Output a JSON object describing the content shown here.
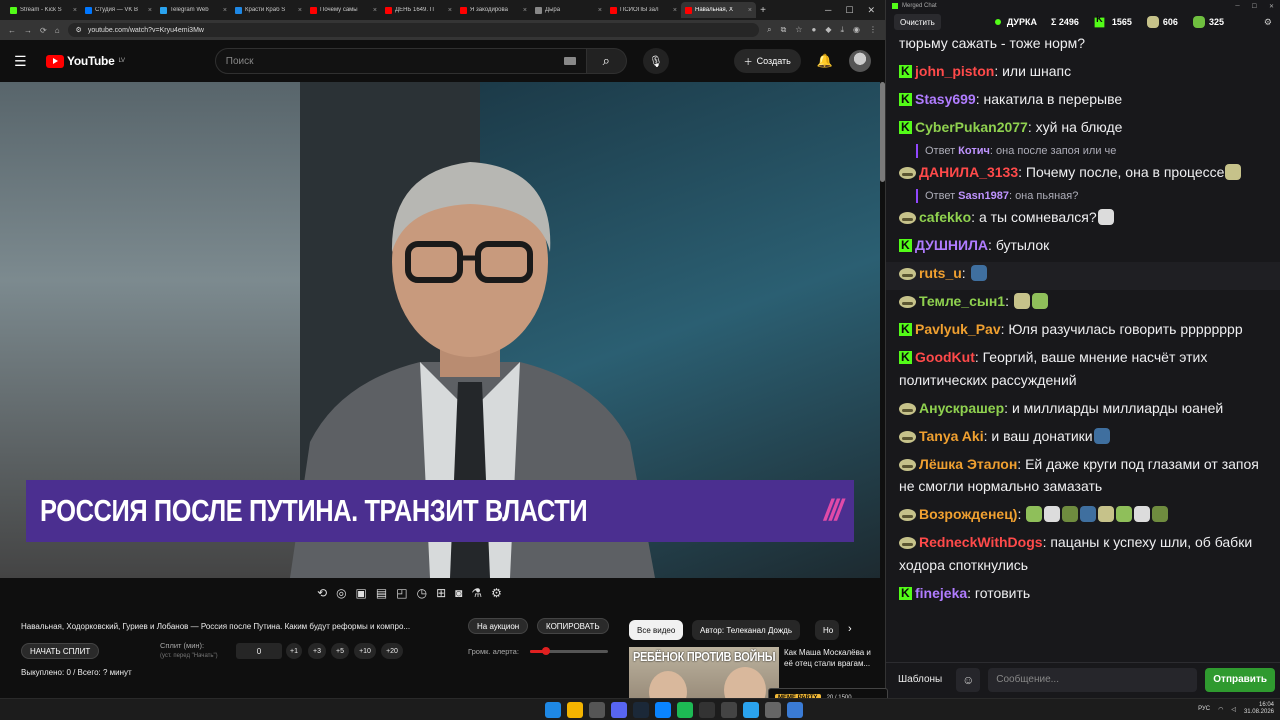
{
  "browser": {
    "tabs": [
      {
        "title": "Stream - Kick S",
        "color": "#53fc18"
      },
      {
        "title": "Студия — VK В",
        "color": "#0077ff"
      },
      {
        "title": "Telegram Web",
        "color": "#2aa3ef"
      },
      {
        "title": "Красти Краб S",
        "color": "#1e88e5"
      },
      {
        "title": "Почему самы",
        "color": "#ff0000"
      },
      {
        "title": "ДЕНЬ 1649. П",
        "color": "#ff0000"
      },
      {
        "title": "Я закодирова",
        "color": "#ff0000"
      },
      {
        "title": "Дырa",
        "color": "#888888"
      },
      {
        "title": "ПСИОПЫ зал",
        "color": "#ff0000"
      },
      {
        "title": "Навальная, Х",
        "color": "#ff0000",
        "active": true
      }
    ],
    "url": "youtube.com/watch?v=Kryu4emi3Mw"
  },
  "youtube": {
    "logo": "YouTube",
    "region": "LV",
    "search_placeholder": "Поиск",
    "create_label": "Создать"
  },
  "video": {
    "caption": "РОССИЯ ПОСЛЕ ПУТИНА. ТРАНЗИТ ВЛАСТИ",
    "channel_mark": "///"
  },
  "panel": {
    "title": "Навальная, Ходорковский, Гуриев и Лобанов — Россия после Путина. Каким будут реформы и компро...",
    "auction_btn": "На аукцион",
    "copy_btn": "КОПИРОВАТЬ",
    "start_split_btn": "НАЧАТЬ СПЛИТ",
    "split_label": "Сплит (мин):",
    "split_hint": "(уст. перед \"Начать\")",
    "split_value": "0",
    "increments": [
      "+1",
      "+3",
      "+5",
      "+10",
      "+20"
    ],
    "volume_label": "Громк. алерта:",
    "volume_level": 0.2,
    "footer": "Выкуплено: 0 / Всего: ? минут"
  },
  "recs": {
    "chips": [
      "Все видео",
      "Автор: Телеканал Дождь",
      "Но"
    ],
    "thumb_text": "РЕБЁНОК ПРОТИВ ВОЙНЫ",
    "title": "Как Маша Москалёва и её отец стали врагам..."
  },
  "chat": {
    "window_title": "Merged Chat",
    "clear_label": "Очистить",
    "channel": "ДУРКА",
    "stats": [
      "Σ 2496",
      "1565",
      "606",
      "325"
    ],
    "templates_label": "Шаблоны",
    "input_placeholder": "Сообщение...",
    "send_label": "Отправить",
    "messages": [
      {
        "badge": "",
        "nick": "",
        "color": "#efeff1",
        "text": "тюрьму сажать - тоже норм?"
      },
      {
        "badge": "kick",
        "nick": "john_piston",
        "color": "#ff4a4a",
        "text": "или шнапс"
      },
      {
        "badge": "kick",
        "nick": "Stasy699",
        "color": "#b07cff",
        "text": "накатила в перерыве"
      },
      {
        "badge": "kick",
        "nick": "CyberPukan2077",
        "color": "#8fd14f",
        "text": "хуй на блюде"
      },
      {
        "reply_to": "Котич",
        "reply_text": "она после запоя или че"
      },
      {
        "badge": "tw",
        "nick": "ДАНИЛА_3133",
        "color": "#ff4a4a",
        "text": "Почему после, она в процессе",
        "emotes": 1
      },
      {
        "reply_to": "Sasn1987",
        "reply_text": "она пьяная?"
      },
      {
        "badge": "tw",
        "nick": "cafekko",
        "color": "#8fd14f",
        "text": "а ты сомневался?",
        "emotes": 1
      },
      {
        "badge": "kick",
        "nick": "ДУШНИЛА",
        "color": "#b07cff",
        "text": "бутылок"
      },
      {
        "badge": "tw",
        "nick": "ruts_u",
        "color": "#f0a030",
        "text": "",
        "emotes": 1,
        "hl": true
      },
      {
        "badge": "tw",
        "nick": "Темле_сын1",
        "color": "#8fd14f",
        "text": "",
        "emotes": 2
      },
      {
        "badge": "kick",
        "nick": "Pavlyuk_Pav",
        "color": "#f0a030",
        "text": "Юля разучилась говорить рррррррр"
      },
      {
        "badge": "kick",
        "nick": "GoodKut",
        "color": "#ff4a4a",
        "text": "Георгий, ваше мнение насчёт этих политических рассуждений"
      },
      {
        "badge": "tw",
        "nick": "Анускрашер",
        "color": "#8fd14f",
        "text": "и миллиарды миллиарды юаней"
      },
      {
        "badge": "tw",
        "nick": "Tanya Aki",
        "color": "#f0a030",
        "text": "и ваш донатики",
        "emotes": 1
      },
      {
        "badge": "tw",
        "nick": "Лёшка Эталон",
        "color": "#f0a030",
        "text": "Ей даже круги под глазами от запоя не смогли нормально замазать"
      },
      {
        "badge": "tw",
        "nick": "Возрожденец)",
        "color": "#f0a030",
        "text": "",
        "emotes": 8
      },
      {
        "badge": "tw",
        "nick": "RedneckWithDogs",
        "color": "#ff4a4a",
        "text": "пацаны к успеху шли, об бабки ходора споткнулись"
      },
      {
        "badge": "kick",
        "nick": "finejeka",
        "color": "#b07cff",
        "text": "готовить"
      }
    ]
  },
  "overlay": {
    "label": "MEME PARTY",
    "value": "20 / 1500"
  },
  "taskbar": {
    "lang": "РУС",
    "time": "16:04",
    "date": "31.08.2026"
  }
}
